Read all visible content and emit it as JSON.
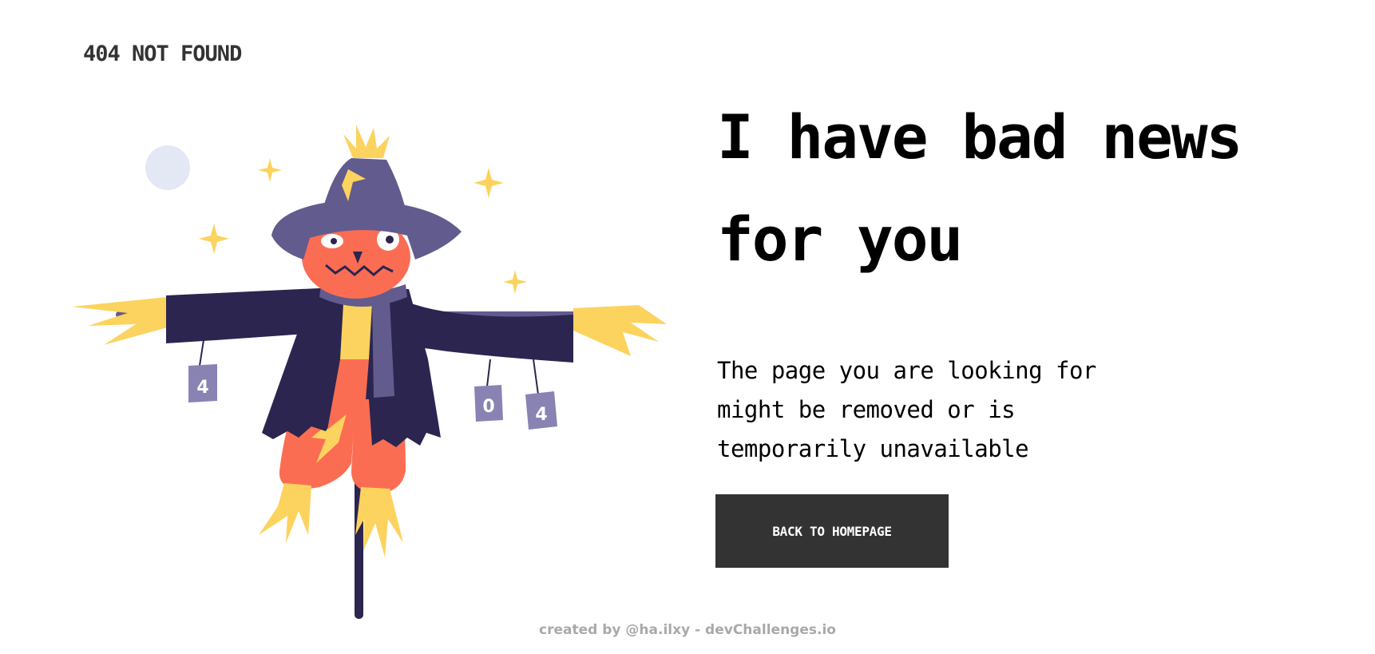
{
  "header": {
    "brand_text": "404 NOT FOUND"
  },
  "main": {
    "headline": "I have bad news for you",
    "message": "The page you are looking for might be removed or is temporarily unavailable",
    "button_label": "BACK TO HOMEPAGE"
  },
  "illustration": {
    "subject": "scarecrow",
    "can_labels": [
      "4",
      "0",
      "4"
    ]
  },
  "footer": {
    "credit": "created by @ha.ilxy - devChallenges.io"
  },
  "colors": {
    "text": "#000000",
    "brand_text": "#333333",
    "button_bg": "#333333",
    "button_text": "#ffffff",
    "footer_text": "#a9a9a9",
    "coat": "#2b2550",
    "hat": "#625b8e",
    "face": "#fb6d53",
    "straw": "#fcd35e",
    "moon": "#e4e8f4"
  }
}
